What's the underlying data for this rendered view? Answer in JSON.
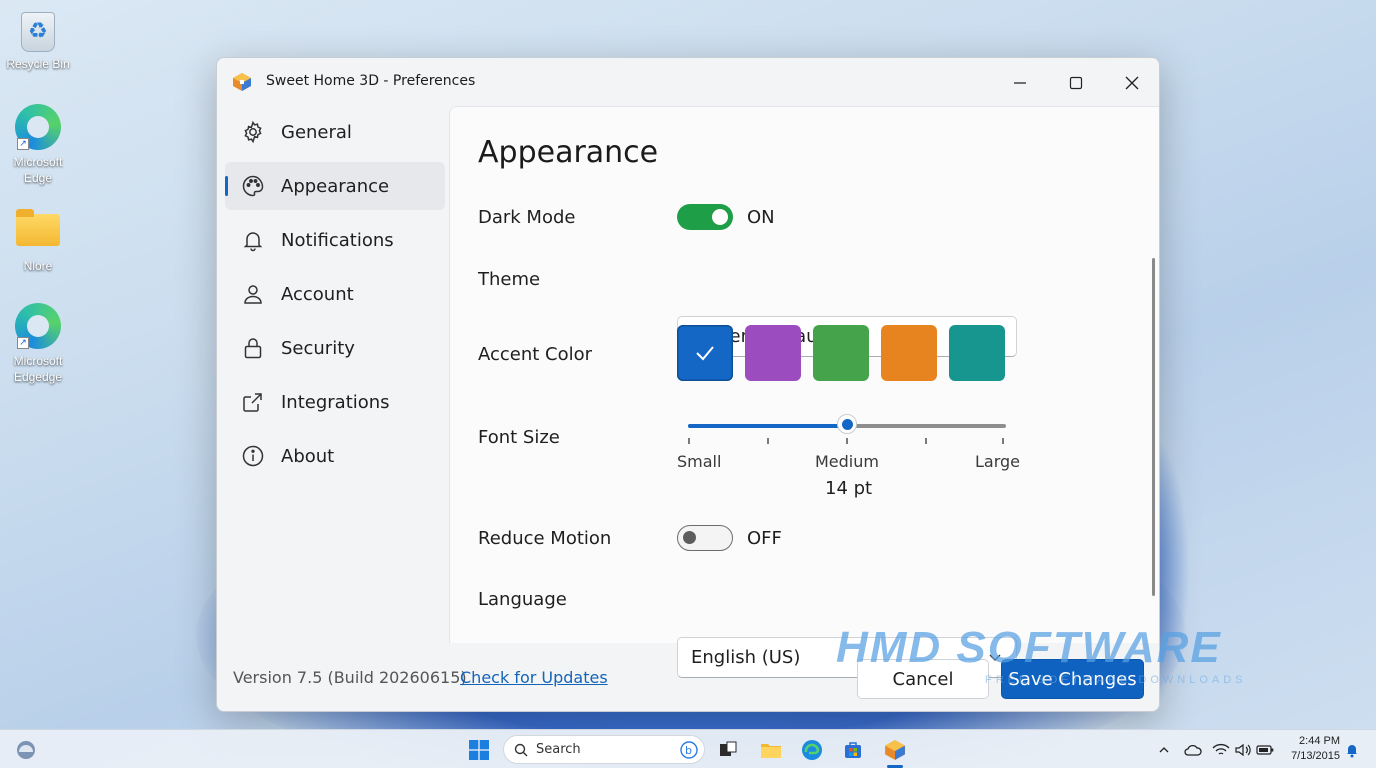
{
  "desktop": {
    "icons": [
      {
        "label": "Resycle Bin"
      },
      {
        "label": "Microsoft Edge"
      },
      {
        "label": "Nlore"
      },
      {
        "label": "Microsoft Edgedge"
      }
    ]
  },
  "window": {
    "title": "Sweet Home 3D - Preferences",
    "controls": [
      "minimize-icon",
      "maximize-icon",
      "close-icon"
    ]
  },
  "sidebar": {
    "items": [
      {
        "label": "General",
        "icon": "gear-icon",
        "active": false
      },
      {
        "label": "Appearance",
        "icon": "palette-icon",
        "active": true
      },
      {
        "label": "Notifications",
        "icon": "bell-icon",
        "active": false
      },
      {
        "label": "Account",
        "icon": "person-icon",
        "active": false
      },
      {
        "label": "Security",
        "icon": "lock-icon",
        "active": false
      },
      {
        "label": "Integrations",
        "icon": "share-icon",
        "active": false
      },
      {
        "label": "About",
        "icon": "info-icon",
        "active": false
      }
    ]
  },
  "appearance": {
    "heading": "Appearance",
    "dark_mode": {
      "label": "Dark Mode",
      "state": "ON"
    },
    "theme": {
      "label": "Theme",
      "value": "System Default"
    },
    "accent": {
      "label": "Accent Color",
      "colors": [
        "#1467c5",
        "#9b4dc0",
        "#45a34c",
        "#e8841f",
        "#16968f"
      ],
      "selected_index": 0
    },
    "font_size": {
      "label": "Font Size",
      "min_label": "Small",
      "mid_label": "Medium",
      "max_label": "Large",
      "value_text": "14 pt",
      "position_fraction": 0.5
    },
    "reduce_motion": {
      "label": "Reduce Motion",
      "state": "OFF"
    },
    "language": {
      "label": "Language",
      "value": "English (US)"
    }
  },
  "footer": {
    "version": "Version 7.5 (Build 20260615)",
    "update_link": "Check for Updates",
    "cancel": "Cancel",
    "save": "Save Changes"
  },
  "watermark": {
    "text": "HMD SOFTWARE",
    "subtext": "FREE SOFTWARE DOWNLOADS"
  },
  "taskbar": {
    "search_placeholder": "Search",
    "time": "2:44 PM",
    "date": "7/13/2015"
  }
}
